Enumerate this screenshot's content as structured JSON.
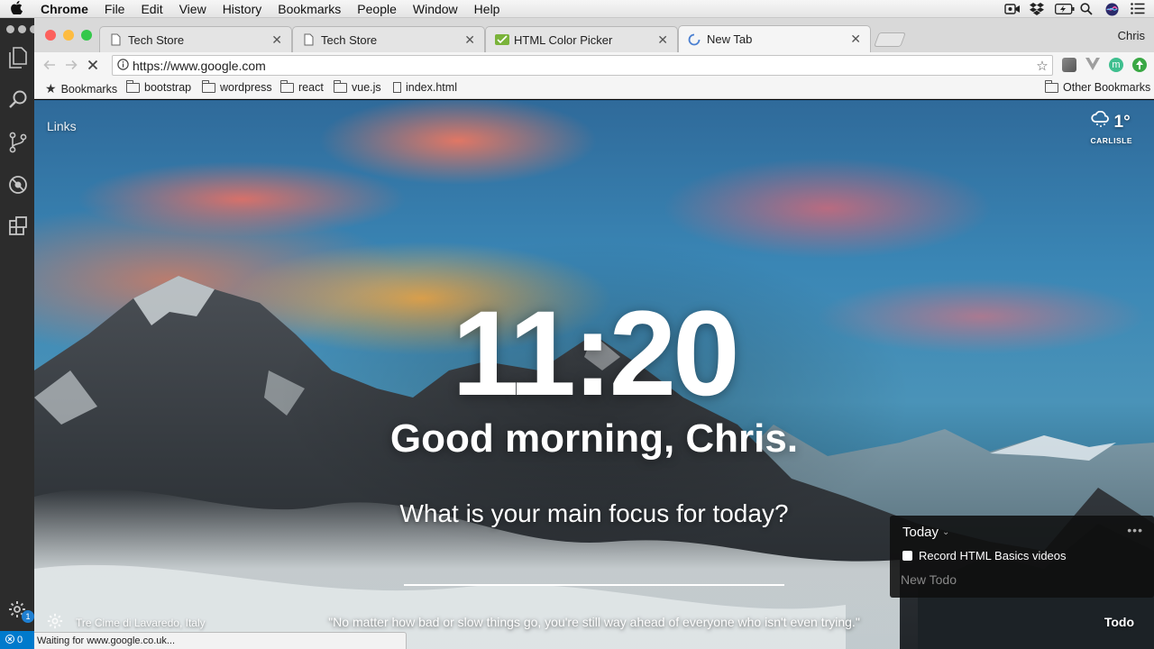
{
  "menubar": {
    "app": "Chrome",
    "items": [
      "File",
      "Edit",
      "View",
      "History",
      "Bookmarks",
      "People",
      "Window",
      "Help"
    ],
    "icons": [
      "screen-record-icon",
      "dropbox-icon",
      "battery-icon",
      "spotlight-icon",
      "siri-icon",
      "notification-center-icon"
    ]
  },
  "vscode": {
    "activity_icons": [
      "explorer-icon",
      "search-icon",
      "source-control-icon",
      "debug-icon",
      "extensions-icon",
      "settings-gear-icon"
    ],
    "badge": "1",
    "status_errors": "0"
  },
  "browser": {
    "profile": "Chris",
    "tabs": [
      {
        "title": "Tech Store",
        "icon": "page-icon",
        "active": false
      },
      {
        "title": "Tech Store",
        "icon": "page-icon",
        "active": false
      },
      {
        "title": "HTML Color Picker",
        "icon": "color-picker-favicon",
        "active": false
      },
      {
        "title": "New Tab",
        "icon": "loading-spinner-icon",
        "active": true
      }
    ],
    "url_prefix": "https://",
    "url": "https://www.google.com",
    "bookmarks": [
      {
        "label": "Bookmarks",
        "icon": "star-icon"
      },
      {
        "label": "bootstrap",
        "icon": "folder-icon"
      },
      {
        "label": "wordpress",
        "icon": "folder-icon"
      },
      {
        "label": "react",
        "icon": "folder-icon"
      },
      {
        "label": "vue.js",
        "icon": "folder-icon"
      },
      {
        "label": "index.html",
        "icon": "page-icon"
      }
    ],
    "other_bookmarks": "Other Bookmarks",
    "status_text": "Waiting for www.google.co.uk..."
  },
  "momentum": {
    "links": "Links",
    "weather": {
      "temp": "1°",
      "location": "CARLISLE",
      "icon": "snow-cloud-icon"
    },
    "time": "11:20",
    "greeting": "Good morning, Chris.",
    "focus_question": "What is your main focus for today?",
    "focus_value": "",
    "todo": {
      "list_name": "Today",
      "items": [
        {
          "text": "Record HTML Basics videos",
          "done": false
        }
      ],
      "new_placeholder": "New Todo",
      "link_label": "Todo"
    },
    "photo_location": "Tre Cime di Lavaredo, Italy",
    "quote": "\"No matter how bad or slow things go, you're still way ahead of everyone who isn't even trying.\""
  }
}
